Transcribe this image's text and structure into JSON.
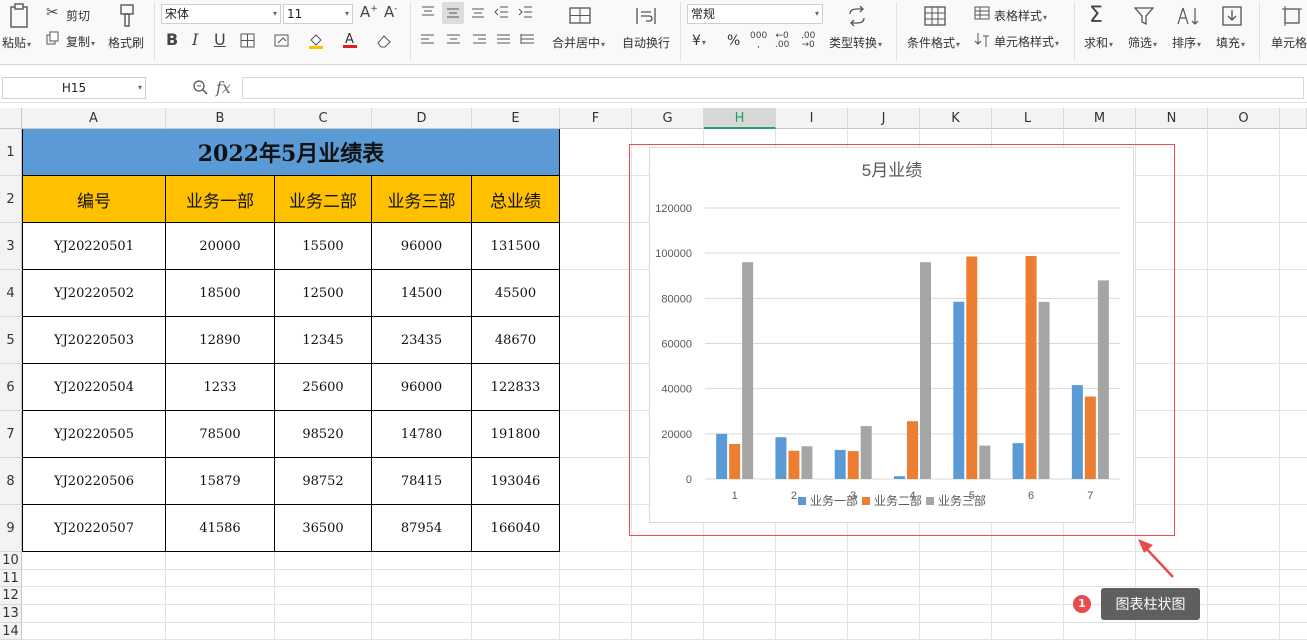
{
  "ribbon": {
    "paste": "粘贴",
    "cut": "剪切",
    "copy": "复制",
    "format_painter": "格式刷",
    "font_name": "宋体",
    "font_size": "11",
    "merge_center": "合并居中",
    "wrap_text": "自动换行",
    "number_format": "常规",
    "currency_symbol": "¥",
    "percent_symbol": "%",
    "type_convert": "类型转换",
    "conditional_format": "条件格式",
    "table_style": "表格样式",
    "cell_style": "单元格样式",
    "sum": "求和",
    "filter": "筛选",
    "sort": "排序",
    "fill": "填充",
    "cell": "单元格"
  },
  "formula_bar": {
    "name_box": "H15",
    "fx": "fx",
    "value": ""
  },
  "columns": [
    "A",
    "B",
    "C",
    "D",
    "E",
    "F",
    "G",
    "H",
    "I",
    "J",
    "K",
    "L",
    "M",
    "N",
    "O"
  ],
  "rows": [
    "1",
    "2",
    "3",
    "4",
    "5",
    "6",
    "7",
    "8",
    "9",
    "10",
    "11",
    "12",
    "13",
    "14"
  ],
  "sheet": {
    "title": "2022年5月业绩表",
    "headers": [
      "编号",
      "业务一部",
      "业务二部",
      "业务三部",
      "总业绩"
    ],
    "data": [
      [
        "YJ20220501",
        "20000",
        "15500",
        "96000",
        "131500"
      ],
      [
        "YJ20220502",
        "18500",
        "12500",
        "14500",
        "45500"
      ],
      [
        "YJ20220503",
        "12890",
        "12345",
        "23435",
        "48670"
      ],
      [
        "YJ20220504",
        "1233",
        "25600",
        "96000",
        "122833"
      ],
      [
        "YJ20220505",
        "78500",
        "98520",
        "14780",
        "191800"
      ],
      [
        "YJ20220506",
        "15879",
        "98752",
        "78415",
        "193046"
      ],
      [
        "YJ20220507",
        "41586",
        "36500",
        "87954",
        "166040"
      ]
    ]
  },
  "chart_data": {
    "type": "bar",
    "title": "5月业绩",
    "categories": [
      "1",
      "2",
      "3",
      "4",
      "5",
      "6",
      "7"
    ],
    "series": [
      {
        "name": "业务一部",
        "color": "#5b9bd5",
        "values": [
          20000,
          18500,
          12890,
          1233,
          78500,
          15879,
          41586
        ]
      },
      {
        "name": "业务二部",
        "color": "#ed7d31",
        "values": [
          15500,
          12500,
          12345,
          25600,
          98520,
          98752,
          36500
        ]
      },
      {
        "name": "业务三部",
        "color": "#a5a5a5",
        "values": [
          96000,
          14500,
          23435,
          96000,
          14780,
          78415,
          87954
        ]
      }
    ],
    "ylim": [
      0,
      120000
    ],
    "yticks": [
      "0",
      "20000",
      "40000",
      "60000",
      "80000",
      "100000",
      "120000"
    ],
    "grid": true,
    "legend_position": "bottom"
  },
  "annotation": {
    "badge": "1",
    "label": "图表柱状图",
    "highlight_color": "#e84c4c"
  },
  "colors": {
    "title_fill": "#5b9bd5",
    "header_fill": "#ffc000",
    "active_column": "#21a366"
  }
}
